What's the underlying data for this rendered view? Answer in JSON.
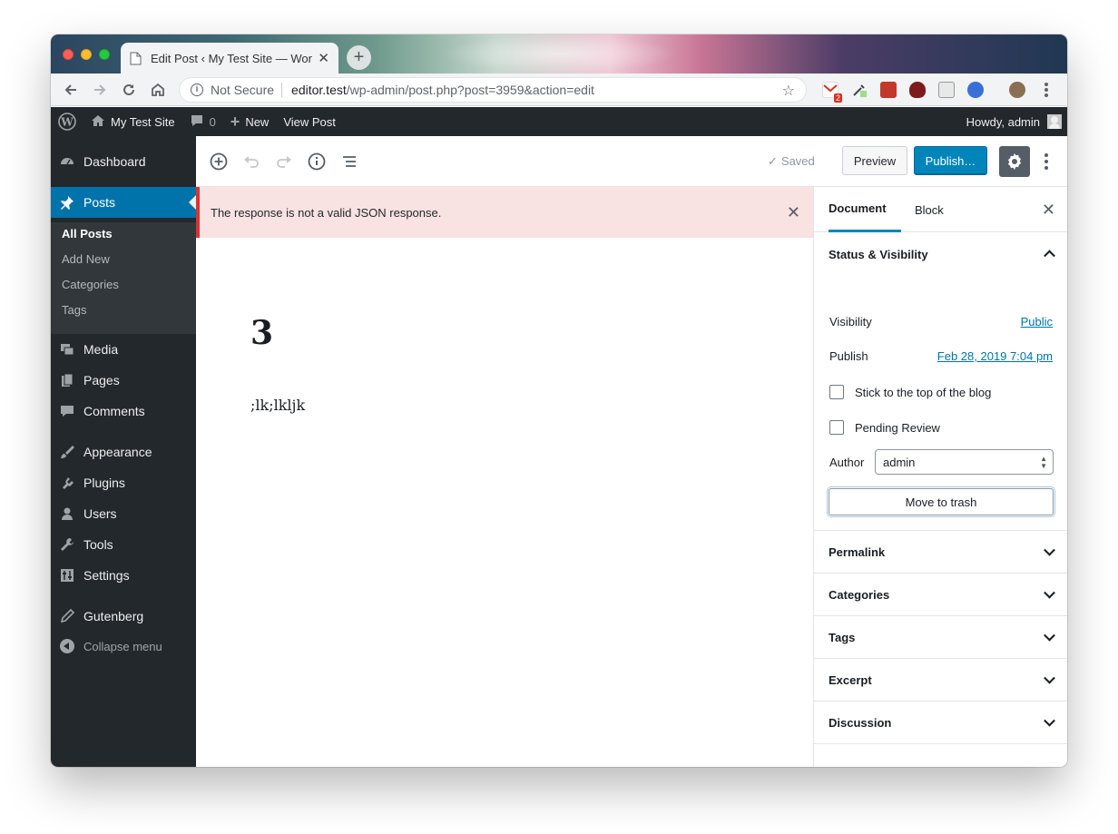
{
  "browser": {
    "tab_title": "Edit Post ‹ My Test Site — Wor",
    "url_security": "Not Secure",
    "url_host": "editor.test",
    "url_path": "/wp-admin/post.php?post=3959&action=edit",
    "gmail_badge": "2"
  },
  "adminbar": {
    "site_name": "My Test Site",
    "comments_count": "0",
    "new_label": "New",
    "view_post": "View Post",
    "howdy": "Howdy, admin"
  },
  "sidebar": {
    "dashboard": "Dashboard",
    "posts": "Posts",
    "sub": [
      "All Posts",
      "Add New",
      "Categories",
      "Tags"
    ],
    "media": "Media",
    "pages": "Pages",
    "comments": "Comments",
    "appearance": "Appearance",
    "plugins": "Plugins",
    "users": "Users",
    "tools": "Tools",
    "settings": "Settings",
    "gutenberg": "Gutenberg",
    "collapse": "Collapse menu"
  },
  "editor": {
    "saved": "Saved",
    "preview": "Preview",
    "publish": "Publish…",
    "notice": "The response is not a valid JSON response.",
    "post_title": "3",
    "paragraph": ";lk;lkljk"
  },
  "settings_panel": {
    "tab_document": "Document",
    "tab_block": "Block",
    "status_title": "Status & Visibility",
    "visibility_label": "Visibility",
    "visibility_value": "Public",
    "publish_label": "Publish",
    "publish_value": "Feb 28, 2019 7:04 pm",
    "stick_label": "Stick to the top of the blog",
    "pending_label": "Pending Review",
    "author_label": "Author",
    "author_value": "admin",
    "trash_label": "Move to trash",
    "panels": [
      "Permalink",
      "Categories",
      "Tags",
      "Excerpt",
      "Discussion"
    ]
  },
  "colors": {
    "wp_dark": "#23282d",
    "wp_blue": "#0073aa",
    "publish_blue": "#0085ba",
    "notice_bg": "#f9e2e2",
    "notice_border": "#dc3232"
  }
}
